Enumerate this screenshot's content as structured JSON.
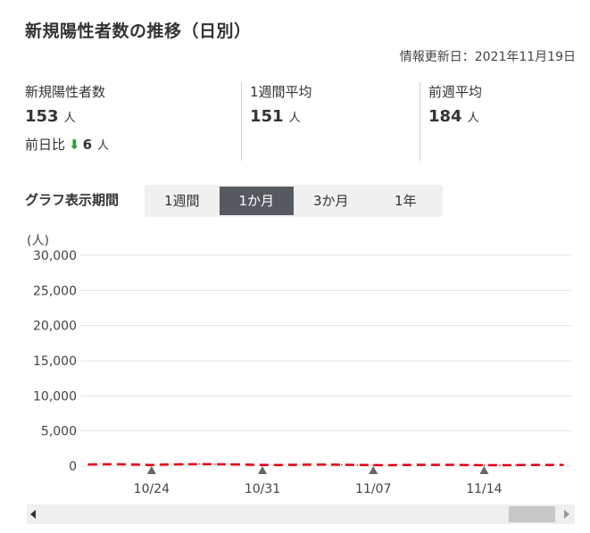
{
  "header": {
    "title": "新規陽性者数の推移（日別）",
    "updated": "情報更新日：2021年11月19日"
  },
  "stats": {
    "new_cases": {
      "label": "新規陽性者数",
      "value": "153",
      "unit": "人"
    },
    "diff": {
      "label": "前日比",
      "arrow": "⬇",
      "value": "6",
      "unit": "人"
    },
    "weekly_avg": {
      "label": "1週間平均",
      "value": "151",
      "unit": "人"
    },
    "prev_week_avg": {
      "label": "前週平均",
      "value": "184",
      "unit": "人"
    }
  },
  "period": {
    "label": "グラフ表示期間",
    "options": [
      "1週間",
      "1か月",
      "3か月",
      "1年"
    ],
    "selected": "1か月"
  },
  "colors": {
    "accent_active": "#555a60",
    "series": "#e60012",
    "down_arrow": "#2e9e3a"
  },
  "chart_data": {
    "type": "line",
    "y_unit": "(人)",
    "ylim": [
      0,
      30000
    ],
    "y_ticks": [
      "30,000",
      "25,000",
      "20,000",
      "15,000",
      "10,000",
      "5,000",
      "0"
    ],
    "y_tick_values": [
      30000,
      25000,
      20000,
      15000,
      10000,
      5000,
      0
    ],
    "x_tick_labels": [
      "10/24",
      "10/31",
      "11/07",
      "11/14"
    ],
    "x_start": "2021-10-20",
    "x_end": "2021-11-19",
    "grid": true,
    "series": [
      {
        "line_style": "dashed",
        "x": [
          "10/20",
          "10/21",
          "10/22",
          "10/23",
          "10/24",
          "10/25",
          "10/26",
          "10/27",
          "10/28",
          "10/29",
          "10/30",
          "10/31",
          "11/01",
          "11/02",
          "11/03",
          "11/04",
          "11/05",
          "11/06",
          "11/07",
          "11/08",
          "11/09",
          "11/10",
          "11/11",
          "11/12",
          "11/13",
          "11/14",
          "11/15",
          "11/16",
          "11/17",
          "11/18",
          "11/19"
        ],
        "values": [
          230,
          250,
          260,
          200,
          150,
          220,
          250,
          280,
          260,
          240,
          200,
          160,
          150,
          180,
          200,
          210,
          190,
          160,
          140,
          130,
          160,
          170,
          180,
          170,
          150,
          130,
          120,
          140,
          160,
          159,
          153
        ]
      }
    ]
  }
}
